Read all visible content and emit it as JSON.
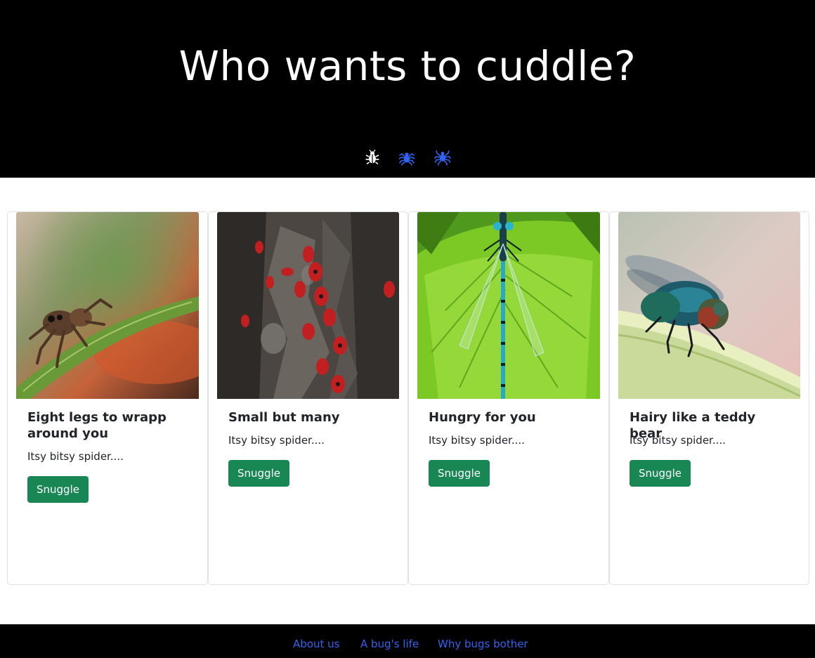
{
  "header": {
    "title": "Who wants to cuddle?",
    "nav_icons": [
      {
        "name": "bug-icon",
        "color": "#ffffff"
      },
      {
        "name": "spider-icon",
        "color": "#2f63f2"
      },
      {
        "name": "spider-web-icon",
        "color": "#2f63f2"
      }
    ]
  },
  "cards": [
    {
      "image": "jumping-spider-photo",
      "title": "Eight legs to wrapp around you",
      "text": "Itsy bitsy spider....",
      "button": "Snuggle"
    },
    {
      "image": "firebugs-on-bark-photo",
      "title": "Small but many",
      "text": "Itsy bitsy spider....",
      "button": "Snuggle"
    },
    {
      "image": "damselfly-on-leaf-photo",
      "title": "Hungry for you",
      "text": "Itsy bitsy spider....",
      "button": "Snuggle"
    },
    {
      "image": "blowfly-on-stem-photo",
      "title": "Hairy like a teddy bear",
      "text": "Itsy bitsy spider....",
      "button": "Snuggle"
    }
  ],
  "footer": {
    "links": [
      "About us",
      "A bug's life",
      "Why bugs bother"
    ]
  },
  "colors": {
    "header_bg": "#000000",
    "accent_link": "#2f63f2",
    "button_bg": "#198754"
  }
}
